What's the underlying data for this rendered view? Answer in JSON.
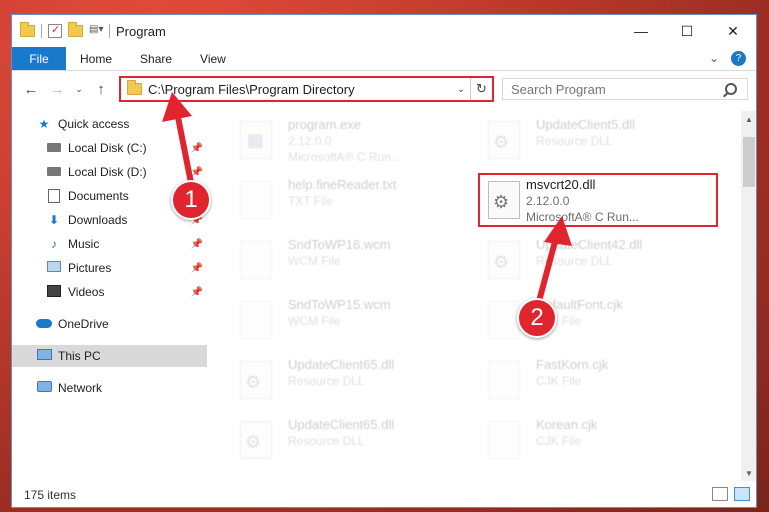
{
  "window": {
    "title": "Program"
  },
  "ribbon": {
    "tabs": [
      "File",
      "Home",
      "Share",
      "View"
    ]
  },
  "address": {
    "path": "C:\\Program Files\\Program Directory"
  },
  "search": {
    "placeholder": "Search Program"
  },
  "sidebar": {
    "items": [
      {
        "label": "Quick access",
        "icon": "star-icon"
      },
      {
        "label": "Local Disk (C:)",
        "icon": "drive-icon",
        "pinned": true
      },
      {
        "label": "Local Disk (D:)",
        "icon": "drive-icon",
        "pinned": true
      },
      {
        "label": "Documents",
        "icon": "document-icon",
        "pinned": true
      },
      {
        "label": "Downloads",
        "icon": "download-icon",
        "pinned": true
      },
      {
        "label": "Music",
        "icon": "music-icon",
        "pinned": true
      },
      {
        "label": "Pictures",
        "icon": "pictures-icon",
        "pinned": true
      },
      {
        "label": "Videos",
        "icon": "videos-icon",
        "pinned": true
      },
      {
        "label": "OneDrive",
        "icon": "cloud-icon"
      },
      {
        "label": "This PC",
        "icon": "computer-icon",
        "selected": true
      },
      {
        "label": "Network",
        "icon": "network-icon"
      }
    ]
  },
  "files": {
    "left": [
      {
        "name": "program.exe",
        "sub1": "2.12.0.0",
        "sub2": "MicrosoftA® C Run...",
        "icon": "exe"
      },
      {
        "name": "help.fineReader.txt",
        "sub1": "TXT File",
        "sub2": "",
        "icon": "blank"
      },
      {
        "name": "SndToWP16.wcm",
        "sub1": "WCM File",
        "sub2": "",
        "icon": "blank"
      },
      {
        "name": "SndToWP15.wcm",
        "sub1": "WCM File",
        "sub2": "",
        "icon": "blank"
      },
      {
        "name": "UpdateClient65.dll",
        "sub1": "Resource DLL",
        "sub2": "",
        "icon": "dll"
      },
      {
        "name": "UpdateClient65.dll",
        "sub1": "Resource DLL",
        "sub2": "",
        "icon": "dll"
      }
    ],
    "right": [
      {
        "name": "UpdateClient5.dll",
        "sub1": "Resource DLL",
        "sub2": "",
        "icon": "dll"
      },
      {
        "name": "msvcrt20.dll",
        "sub1": "2.12.0.0",
        "sub2": "MicrosoftA® C Run...",
        "icon": "dll",
        "highlight": true
      },
      {
        "name": "UpdateClient42.dll",
        "sub1": "Resource DLL",
        "sub2": "",
        "icon": "dll"
      },
      {
        "name": "DefaultFont.cjk",
        "sub1": "CJK File",
        "sub2": "",
        "icon": "blank"
      },
      {
        "name": "FastKorn.cjk",
        "sub1": "CJK File",
        "sub2": "",
        "icon": "blank"
      },
      {
        "name": "Korean.cjk",
        "sub1": "CJK File",
        "sub2": "",
        "icon": "blank"
      }
    ]
  },
  "status": {
    "count": "175 items"
  },
  "annotations": {
    "step1": "1",
    "step2": "2",
    "color": "#e1252f"
  }
}
